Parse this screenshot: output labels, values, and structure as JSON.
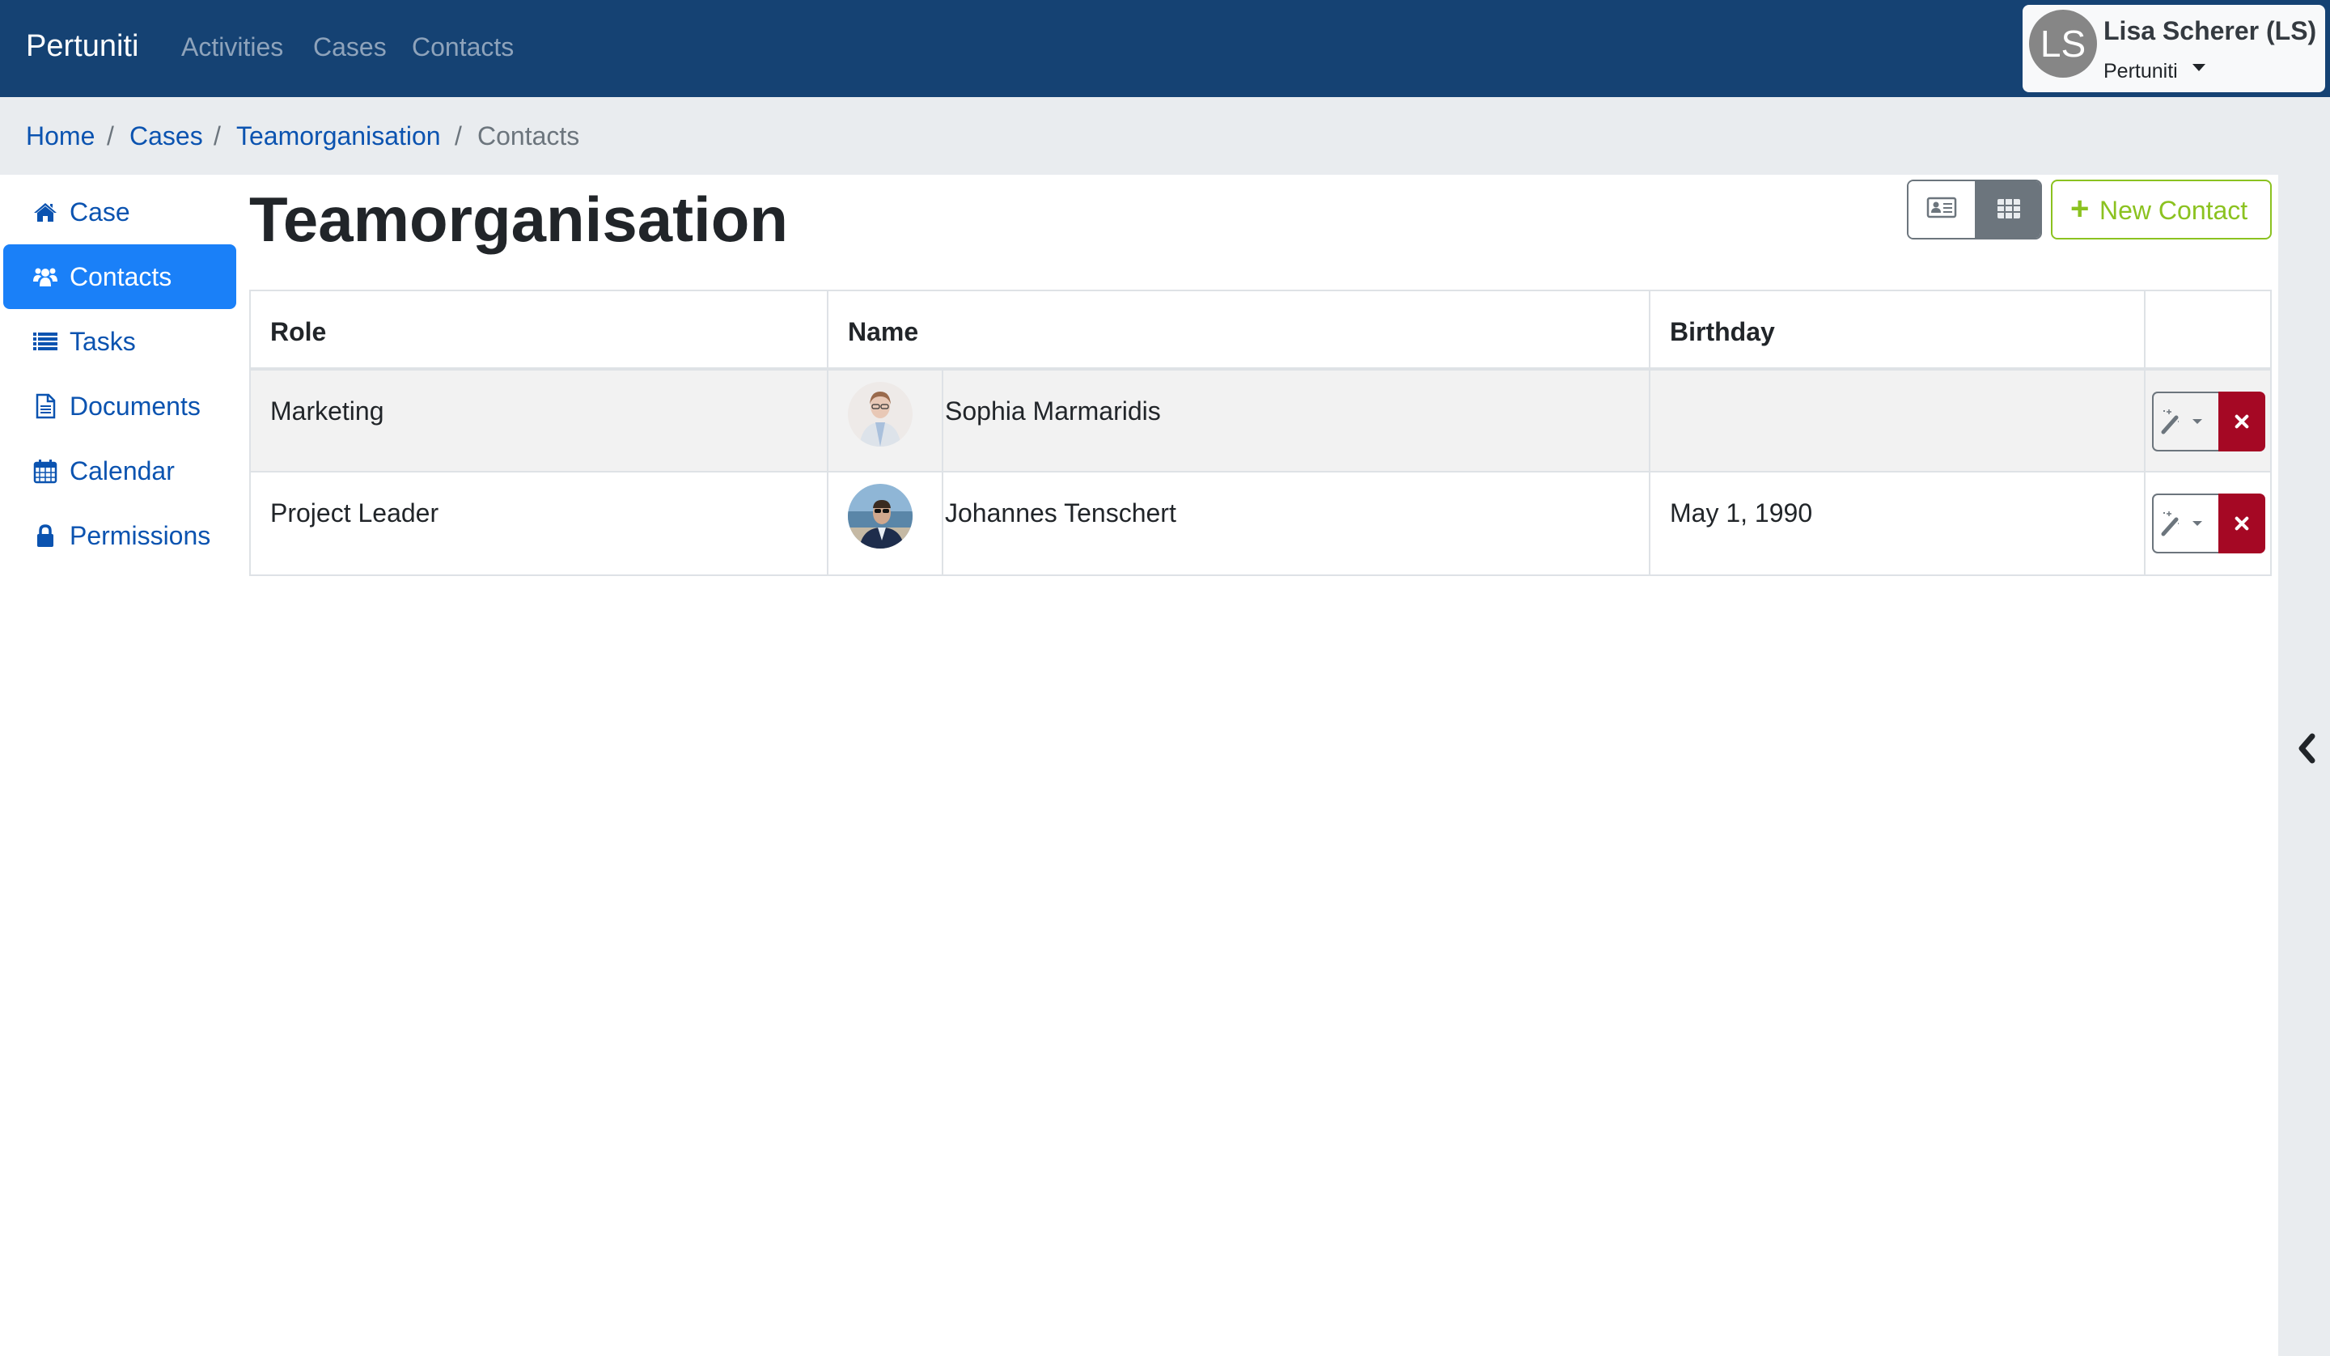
{
  "navbar": {
    "brand": "Pertuniti",
    "links": [
      "Activities",
      "Cases",
      "Contacts"
    ],
    "user": {
      "initials": "LS",
      "name": "Lisa Scherer (LS)",
      "organization": "Pertuniti"
    }
  },
  "breadcrumb": {
    "items": [
      "Home",
      "Cases",
      "Teamorganisation"
    ],
    "active": "Contacts",
    "separator": "/"
  },
  "sidebar": {
    "items": [
      {
        "label": "Case",
        "icon": "home-icon"
      },
      {
        "label": "Contacts",
        "icon": "users-icon",
        "active": true
      },
      {
        "label": "Tasks",
        "icon": "list-icon"
      },
      {
        "label": "Documents",
        "icon": "document-icon"
      },
      {
        "label": "Calendar",
        "icon": "calendar-icon"
      },
      {
        "label": "Permissions",
        "icon": "lock-icon"
      }
    ]
  },
  "main": {
    "title": "Teamorganisation",
    "view_toggle": {
      "card_view": "id-card-icon",
      "table_view": "grid-icon",
      "selected": "table"
    },
    "new_contact_label": "New Contact",
    "table": {
      "headers": [
        "Role",
        "Name",
        "Birthday",
        ""
      ],
      "rows": [
        {
          "role": "Marketing",
          "name": "Sophia Marmaridis",
          "birthday": "",
          "avatar": "photo"
        },
        {
          "role": "Project Leader",
          "name": "Johannes Tenschert",
          "birthday": "May 1, 1990",
          "avatar": "photo"
        }
      ]
    }
  },
  "colors": {
    "navbar": "#154273",
    "link": "#0b53b0",
    "active": "#1a80f8",
    "success": "#8bc220",
    "danger": "#a50824",
    "secondary": "#6c757d"
  }
}
